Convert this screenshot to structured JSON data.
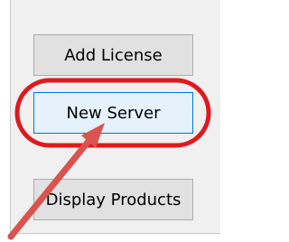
{
  "buttons": {
    "add_license": "Add License",
    "new_server": "New Server",
    "display_products": "Display Products"
  },
  "annotation": {
    "highlight_color": "#e0191d",
    "arrow_color": "#d9534f",
    "highlight_shape": "rounded-rectangle",
    "arrow_icon": "arrow-pointing-up-right"
  }
}
